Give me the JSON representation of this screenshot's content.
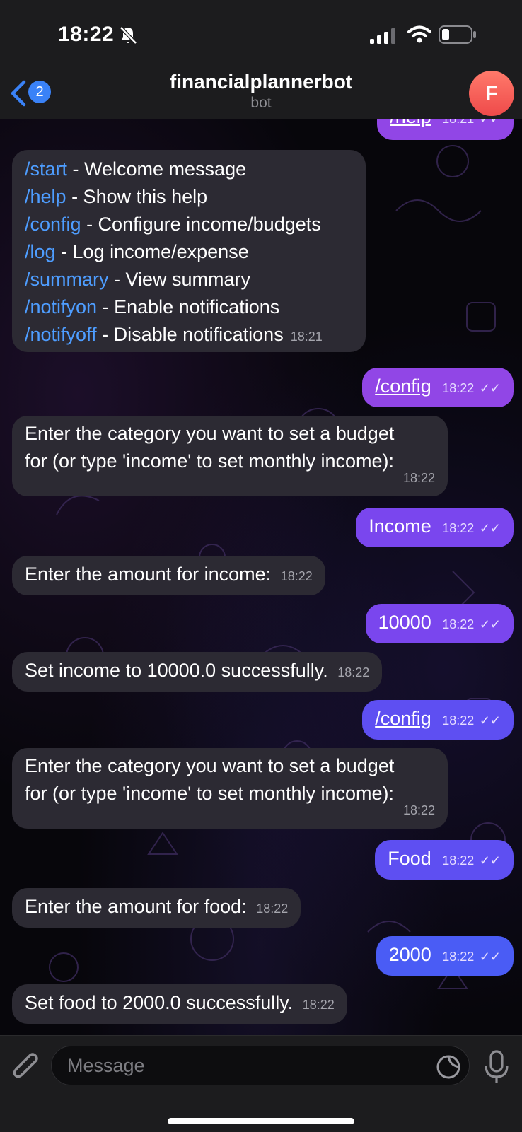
{
  "status_bar": {
    "time": "18:22",
    "icons": [
      "bell-slash-icon",
      "cellular-signal-icon",
      "wifi-icon",
      "battery-icon"
    ]
  },
  "header": {
    "back_icon": "chevron-left-icon",
    "unread_count": "2",
    "title": "financialplannerbot",
    "subtitle": "bot",
    "avatar_letter": "F"
  },
  "messages": {
    "m0": {
      "text": "/help",
      "time": "18:21"
    },
    "m1": {
      "commands": [
        {
          "cmd": "/start",
          "desc": " - Welcome message"
        },
        {
          "cmd": "/help",
          "desc": " - Show this help"
        },
        {
          "cmd": "/config",
          "desc": " - Configure income/budgets"
        },
        {
          "cmd": "/log",
          "desc": " - Log income/expense"
        },
        {
          "cmd": "/summary",
          "desc": " - View summary"
        },
        {
          "cmd": "/notifyon",
          "desc": " - Enable notifications"
        },
        {
          "cmd": "/notifyoff",
          "desc": " - Disable notifications"
        }
      ],
      "time": "18:21"
    },
    "m2": {
      "text": "/config",
      "time": "18:22"
    },
    "m3": {
      "line1": "Enter the category you want to set a budget",
      "line2": "for (or type 'income' to set monthly income):",
      "time": "18:22"
    },
    "m4": {
      "text": "Income",
      "time": "18:22"
    },
    "m5": {
      "text": "Enter the amount for income:",
      "time": "18:22"
    },
    "m6": {
      "text": "10000",
      "time": "18:22"
    },
    "m7": {
      "text": "Set income to 10000.0 successfully.",
      "time": "18:22"
    },
    "m8": {
      "text": "/config",
      "time": "18:22"
    },
    "m9": {
      "line1": "Enter the category you want to set a budget",
      "line2": "for (or type 'income' to set monthly income):",
      "time": "18:22"
    },
    "m10": {
      "text": "Food",
      "time": "18:22"
    },
    "m11": {
      "text": "Enter the amount for food:",
      "time": "18:22"
    },
    "m12": {
      "text": "2000",
      "time": "18:22"
    },
    "m13": {
      "text": "Set food to 2000.0 successfully.",
      "time": "18:22"
    }
  },
  "input_bar": {
    "placeholder": "Message",
    "icons": [
      "paperclip-icon",
      "sticker-icon",
      "microphone-icon"
    ]
  },
  "colors": {
    "incoming_bubble": "#2c2a33",
    "outgoing_bubble_top": "#9146e6",
    "outgoing_bubble_bottom": "#4a5cf5",
    "command_link": "#4e9dff",
    "accent_blue": "#3a82f7",
    "avatar": "#ef4a4a"
  }
}
